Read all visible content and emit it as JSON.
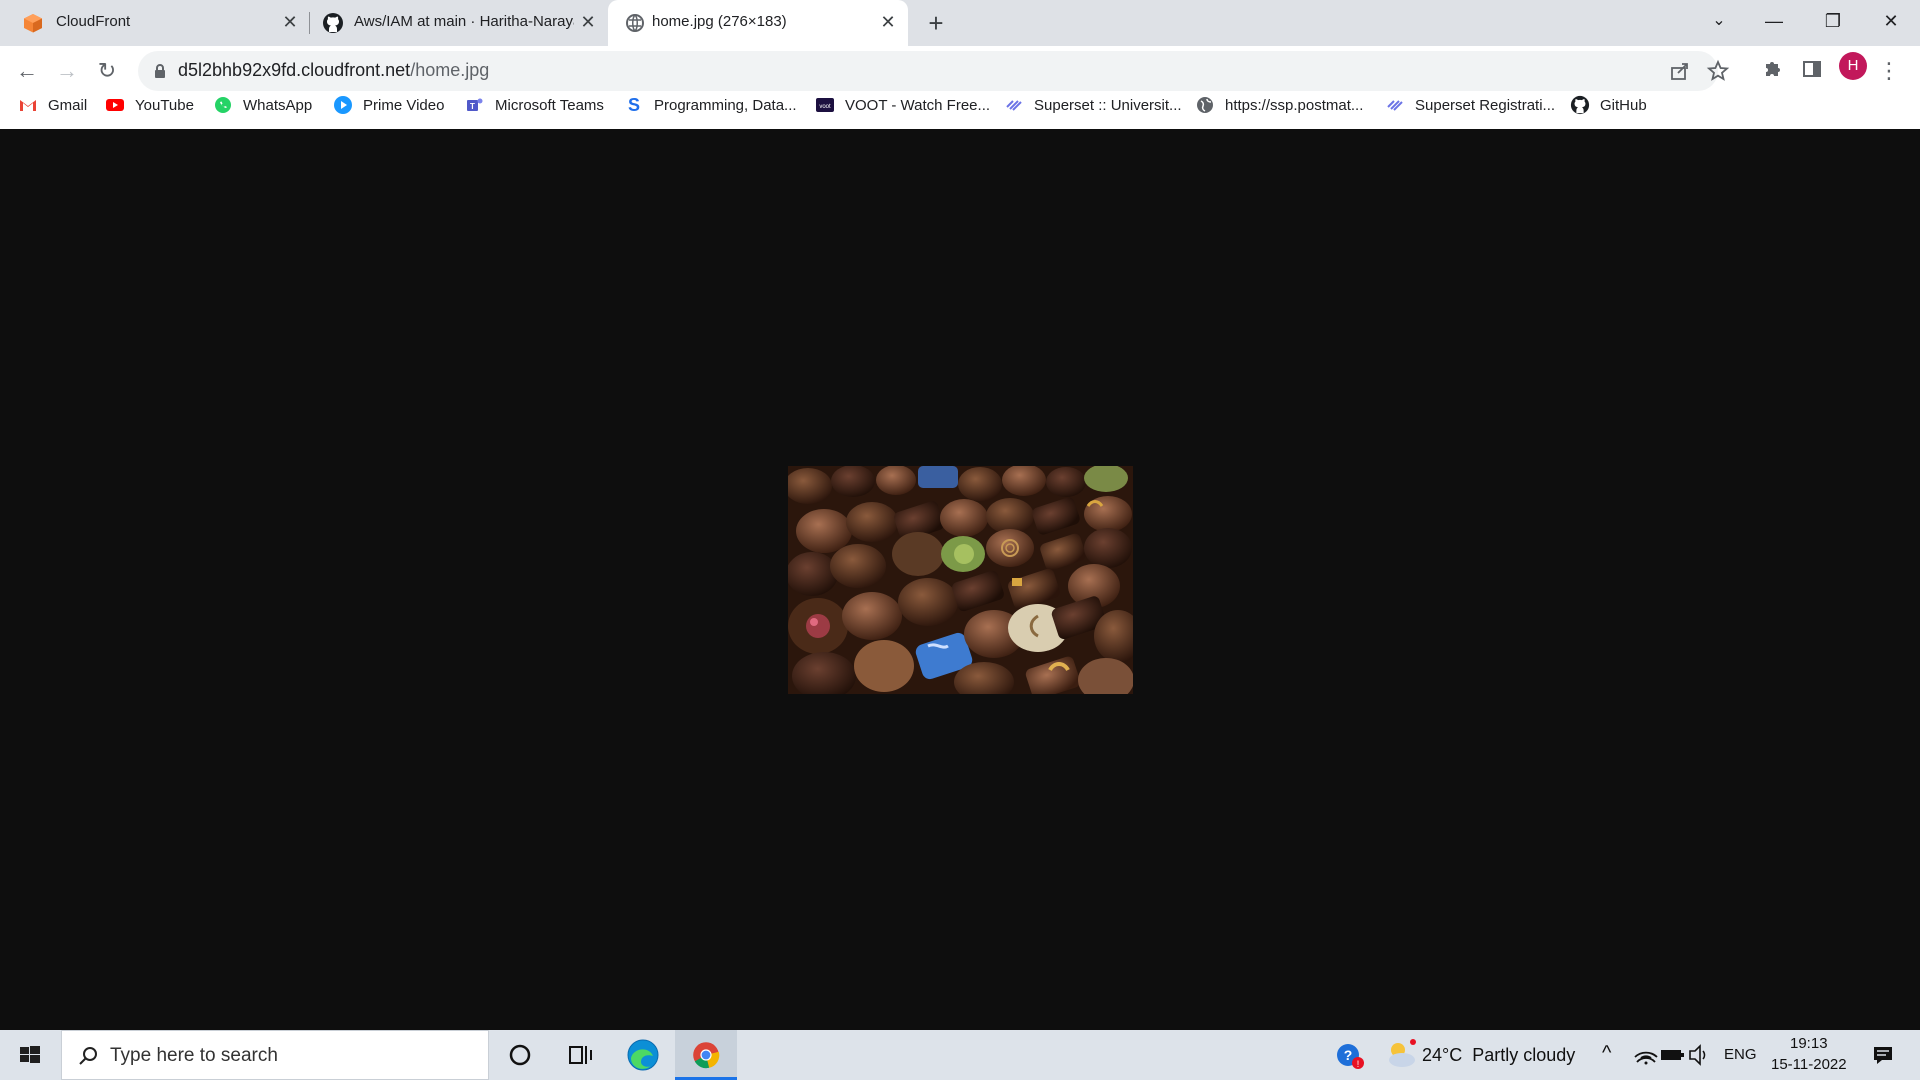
{
  "browser": {
    "tabs": [
      {
        "title": "CloudFront",
        "icon": "aws-cube-icon",
        "active": false
      },
      {
        "title": "Aws/IAM at main · Haritha-Narayanan",
        "icon": "github-icon",
        "active": false
      },
      {
        "title": "home.jpg (276×183)",
        "icon": "globe-icon",
        "active": true
      }
    ],
    "url_host": "d5l2bhb92x9fd.cloudfront.net",
    "url_path": "/home.jpg",
    "profile_initial": "H",
    "bookmarks": [
      {
        "label": "Gmail",
        "icon": "gmail-icon"
      },
      {
        "label": "YouTube",
        "icon": "youtube-icon"
      },
      {
        "label": "WhatsApp",
        "icon": "whatsapp-icon"
      },
      {
        "label": "Prime Video",
        "icon": "prime-video-icon"
      },
      {
        "label": "Microsoft Teams",
        "icon": "teams-icon"
      },
      {
        "label": "Programming, Data...",
        "icon": "s-icon"
      },
      {
        "label": "VOOT - Watch Free...",
        "icon": "voot-icon"
      },
      {
        "label": "Superset :: Universit...",
        "icon": "superset-icon"
      },
      {
        "label": "https://ssp.postmat...",
        "icon": "globe-icon"
      },
      {
        "label": "Superset Registrati...",
        "icon": "superset-icon"
      },
      {
        "label": "GitHub",
        "icon": "github-icon"
      }
    ]
  },
  "taskbar": {
    "search_placeholder": "Type here to search",
    "weather": "24°C  Partly cloudy",
    "language": "ENG",
    "time": "19:13",
    "date": "15-11-2022"
  },
  "colors": {
    "page_bg": "#0e0e0e",
    "tabstrip_bg": "#dee1e6",
    "taskbar_bg": "#dde3ea",
    "accent": "#1a73e8"
  }
}
